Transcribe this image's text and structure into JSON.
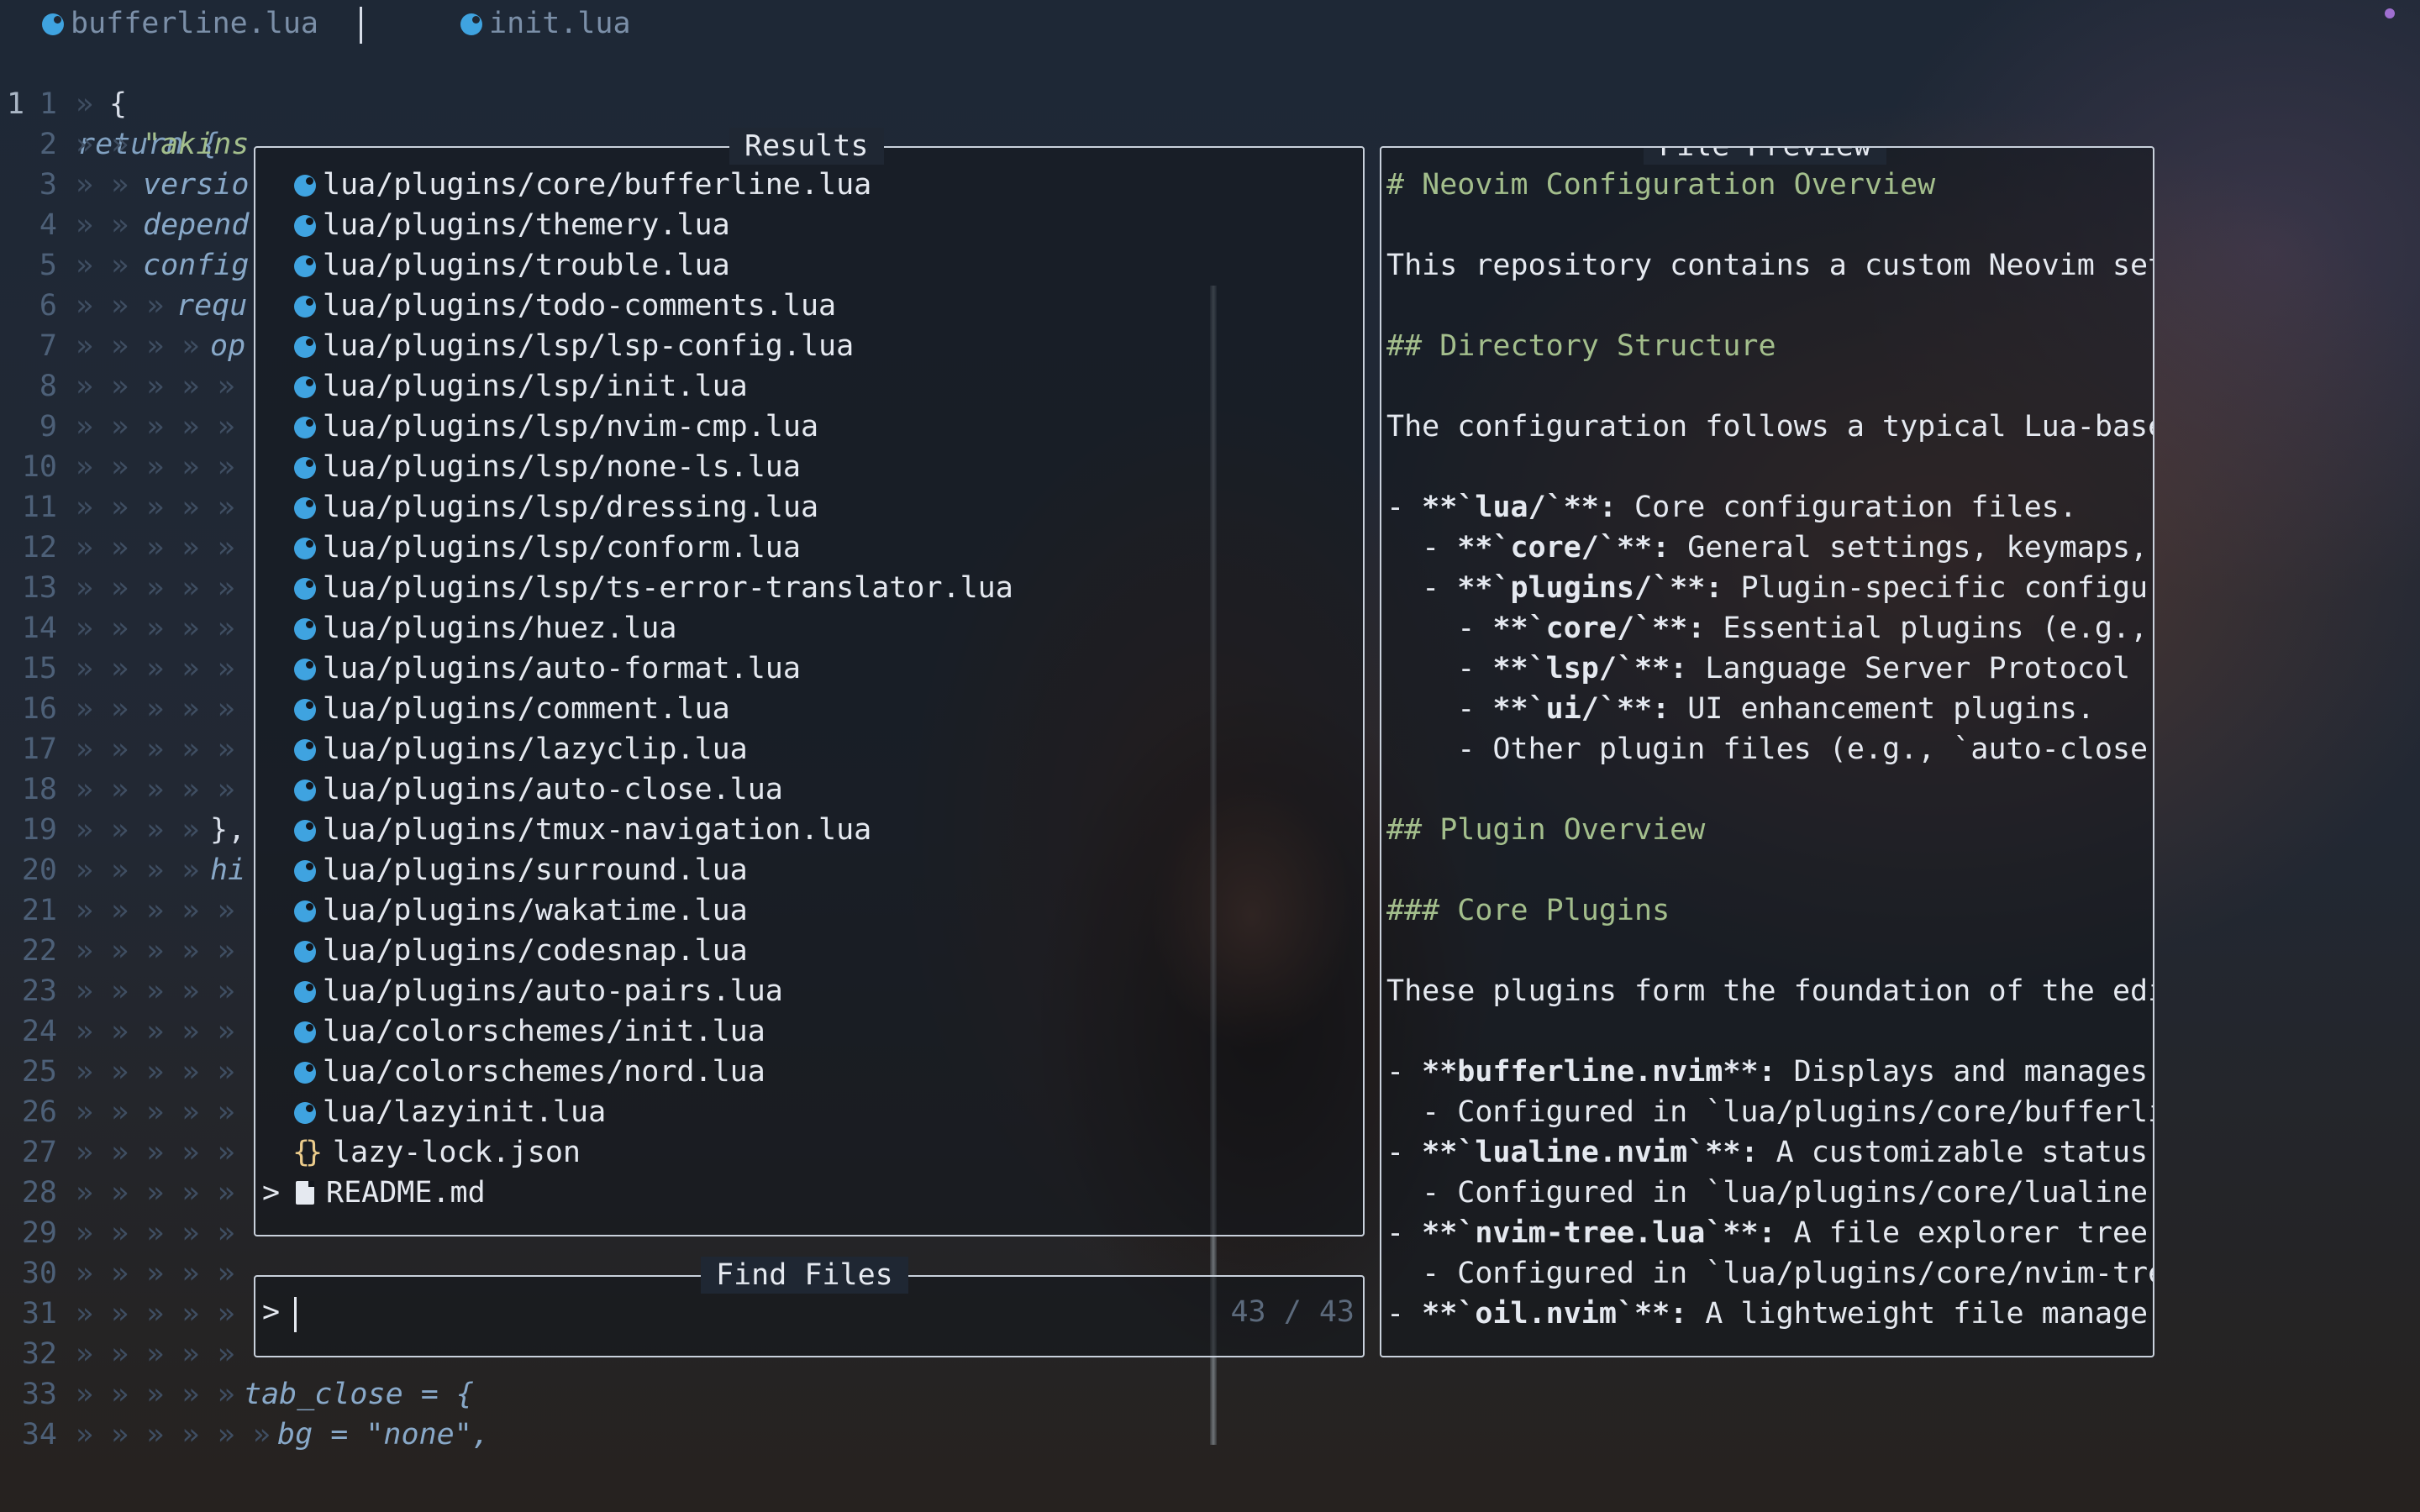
{
  "tabs": [
    {
      "icon": "lua-icon",
      "label": "bufferline.lua"
    },
    {
      "icon": "lua-icon",
      "label": "init.lua"
    }
  ],
  "editor": {
    "first_line": {
      "num": "1",
      "text": "return {"
    },
    "lines": [
      {
        "num": "1",
        "guides": "» ",
        "code": "{"
      },
      {
        "num": "2",
        "guides": "» » ",
        "code": "\"akins"
      },
      {
        "num": "3",
        "guides": "» » ",
        "code": "versio"
      },
      {
        "num": "4",
        "guides": "» » ",
        "code": "depend"
      },
      {
        "num": "5",
        "guides": "» » ",
        "code": "config"
      },
      {
        "num": "6",
        "guides": "» » » ",
        "code": "requ"
      },
      {
        "num": "7",
        "guides": "» » » » ",
        "code": "op"
      },
      {
        "num": "8",
        "guides": "» » » » » ",
        "code": ""
      },
      {
        "num": "9",
        "guides": "» » » » » ",
        "code": ""
      },
      {
        "num": "10",
        "guides": "» » » » » ",
        "code": ""
      },
      {
        "num": "11",
        "guides": "» » » » » ",
        "code": ""
      },
      {
        "num": "12",
        "guides": "» » » » » ",
        "code": ""
      },
      {
        "num": "13",
        "guides": "» » » » » ",
        "code": ""
      },
      {
        "num": "14",
        "guides": "» » » » » ",
        "code": ""
      },
      {
        "num": "15",
        "guides": "» » » » » ",
        "code": ""
      },
      {
        "num": "16",
        "guides": "» » » » » ",
        "code": ""
      },
      {
        "num": "17",
        "guides": "» » » » » ",
        "code": ""
      },
      {
        "num": "18",
        "guides": "» » » » » ",
        "code": ""
      },
      {
        "num": "19",
        "guides": "» » » » ",
        "code": "},"
      },
      {
        "num": "20",
        "guides": "» » » » ",
        "code": "hi"
      },
      {
        "num": "21",
        "guides": "» » » » » ",
        "code": ""
      },
      {
        "num": "22",
        "guides": "» » » » » ",
        "code": ""
      },
      {
        "num": "23",
        "guides": "» » » » » ",
        "code": ""
      },
      {
        "num": "24",
        "guides": "» » » » » ",
        "code": ""
      },
      {
        "num": "25",
        "guides": "» » » » » ",
        "code": ""
      },
      {
        "num": "26",
        "guides": "» » » » » ",
        "code": ""
      },
      {
        "num": "27",
        "guides": "» » » » » ",
        "code": ""
      },
      {
        "num": "28",
        "guides": "» » » » » ",
        "code": ""
      },
      {
        "num": "29",
        "guides": "» » » » » ",
        "code": ""
      },
      {
        "num": "30",
        "guides": "» » » » » ",
        "code": ""
      },
      {
        "num": "31",
        "guides": "» » » » » ",
        "code": ""
      },
      {
        "num": "32",
        "guides": "» » » » » ",
        "code": ""
      },
      {
        "num": "33",
        "guides": "» » » » » ",
        "code": "tab_close = {"
      },
      {
        "num": "34",
        "guides": "» » » » » » ",
        "code": "bg = \"none\","
      }
    ]
  },
  "results": {
    "title": "Results",
    "selected_marker": ">",
    "items": [
      {
        "icon": "lua-icon",
        "label": "lua/plugins/core/bufferline.lua"
      },
      {
        "icon": "lua-icon",
        "label": "lua/plugins/themery.lua"
      },
      {
        "icon": "lua-icon",
        "label": "lua/plugins/trouble.lua"
      },
      {
        "icon": "lua-icon",
        "label": "lua/plugins/todo-comments.lua"
      },
      {
        "icon": "lua-icon",
        "label": "lua/plugins/lsp/lsp-config.lua"
      },
      {
        "icon": "lua-icon",
        "label": "lua/plugins/lsp/init.lua"
      },
      {
        "icon": "lua-icon",
        "label": "lua/plugins/lsp/nvim-cmp.lua"
      },
      {
        "icon": "lua-icon",
        "label": "lua/plugins/lsp/none-ls.lua"
      },
      {
        "icon": "lua-icon",
        "label": "lua/plugins/lsp/dressing.lua"
      },
      {
        "icon": "lua-icon",
        "label": "lua/plugins/lsp/conform.lua"
      },
      {
        "icon": "lua-icon",
        "label": "lua/plugins/lsp/ts-error-translator.lua"
      },
      {
        "icon": "lua-icon",
        "label": "lua/plugins/huez.lua"
      },
      {
        "icon": "lua-icon",
        "label": "lua/plugins/auto-format.lua"
      },
      {
        "icon": "lua-icon",
        "label": "lua/plugins/comment.lua"
      },
      {
        "icon": "lua-icon",
        "label": "lua/plugins/lazyclip.lua"
      },
      {
        "icon": "lua-icon",
        "label": "lua/plugins/auto-close.lua"
      },
      {
        "icon": "lua-icon",
        "label": "lua/plugins/tmux-navigation.lua"
      },
      {
        "icon": "lua-icon",
        "label": "lua/plugins/surround.lua"
      },
      {
        "icon": "lua-icon",
        "label": "lua/plugins/wakatime.lua"
      },
      {
        "icon": "lua-icon",
        "label": "lua/plugins/codesnap.lua"
      },
      {
        "icon": "lua-icon",
        "label": "lua/plugins/auto-pairs.lua"
      },
      {
        "icon": "lua-icon",
        "label": "lua/colorschemes/init.lua"
      },
      {
        "icon": "lua-icon",
        "label": "lua/colorschemes/nord.lua"
      },
      {
        "icon": "lua-icon",
        "label": "lua/lazyinit.lua"
      },
      {
        "icon": "json-icon",
        "icon_text": "{}",
        "label": "lazy-lock.json"
      },
      {
        "icon": "markdown-file-icon",
        "label": "README.md",
        "selected": true
      }
    ]
  },
  "find": {
    "title": "Find Files",
    "prompt": ">",
    "value": "",
    "count": "43 / 43"
  },
  "preview": {
    "title": "File Preview",
    "lines": [
      {
        "text": "# Neovim Configuration Overview",
        "style": "heading"
      },
      {
        "text": "",
        "style": "plain"
      },
      {
        "text": "This repository contains a custom Neovim setu",
        "style": "plain"
      },
      {
        "text": "",
        "style": "plain"
      },
      {
        "text": "## Directory Structure",
        "style": "heading"
      },
      {
        "text": "",
        "style": "plain"
      },
      {
        "text": "The configuration follows a typical Lua-based",
        "style": "plain"
      },
      {
        "text": "",
        "style": "plain"
      },
      {
        "prefix": "- ",
        "bold": "**`lua/`**:",
        "rest": " Core configuration files.",
        "style": "bullet"
      },
      {
        "prefix": "  - ",
        "bold": "**`core/`**:",
        "rest": " General settings, keymaps, a",
        "style": "bullet"
      },
      {
        "prefix": "  - ",
        "bold": "**`plugins/`**:",
        "rest": " Plugin-specific configura",
        "style": "bullet"
      },
      {
        "prefix": "    - ",
        "bold": "**`core/`**:",
        "rest": " Essential plugins (e.g., B",
        "style": "bullet"
      },
      {
        "prefix": "    - ",
        "bold": "**`lsp/`**:",
        "rest": " Language Server Protocol (L",
        "style": "bullet"
      },
      {
        "prefix": "    - ",
        "bold": "**`ui/`**:",
        "rest": " UI enhancement plugins.",
        "style": "bullet"
      },
      {
        "text": "    - Other plugin files (e.g., `auto-close.l",
        "style": "plain"
      },
      {
        "text": "",
        "style": "plain"
      },
      {
        "text": "## Plugin Overview",
        "style": "heading"
      },
      {
        "text": "",
        "style": "plain"
      },
      {
        "text": "### Core Plugins",
        "style": "heading"
      },
      {
        "text": "",
        "style": "plain"
      },
      {
        "text": "These plugins form the foundation of the edit",
        "style": "plain"
      },
      {
        "text": "",
        "style": "plain"
      },
      {
        "prefix": "- ",
        "bold": "**bufferline.nvim**:",
        "rest": " Displays and manages",
        "style": "bullet"
      },
      {
        "text": "  - Configured in `lua/plugins/core/bufferlin",
        "style": "plain"
      },
      {
        "prefix": "- ",
        "bold": "**`lualine.nvim`**:",
        "rest": " A customizable status l",
        "style": "bullet"
      },
      {
        "text": "  - Configured in `lua/plugins/core/lualine.l",
        "style": "plain"
      },
      {
        "prefix": "- ",
        "bold": "**`nvim-tree.lua`**:",
        "rest": " A file explorer tree.",
        "style": "bullet"
      },
      {
        "text": "  - Configured in `lua/plugins/core/nvim-tree",
        "style": "plain"
      },
      {
        "prefix": "- ",
        "bold": "**`oil.nvim`**:",
        "rest": " A lightweight file manager",
        "style": "bullet"
      }
    ]
  },
  "colors": {
    "background": "#1f2733",
    "border": "#c9d1dc",
    "heading": "#a3be8c",
    "lua_icon": "#3fa3e0",
    "json_icon": "#ebcb8b",
    "line_number": "#4d6078"
  }
}
